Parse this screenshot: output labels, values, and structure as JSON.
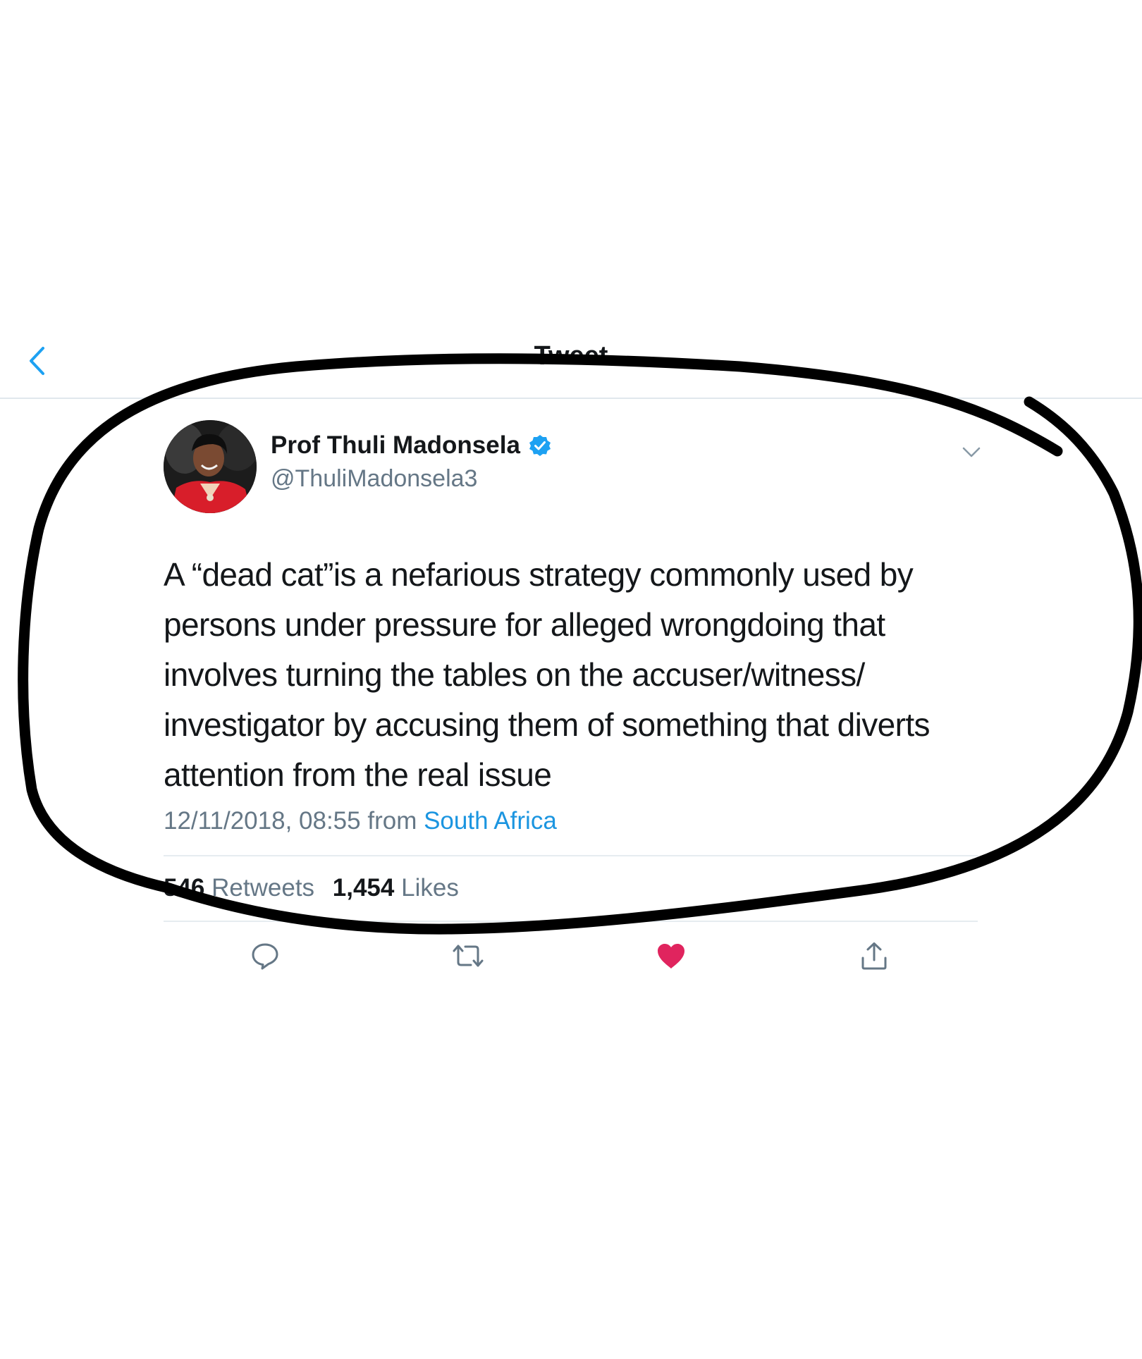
{
  "nav": {
    "title": "Tweet"
  },
  "tweet": {
    "author_name": "Prof Thuli Madonsela",
    "author_handle": "@ThuliMadonsela3",
    "verified": true,
    "text": "A “dead cat”is a nefarious strategy commonly used by\npersons under pressure for alleged wrongdoing that\ninvolves turning the tables on the accuser/witness/\ninvestigator by accusing them of something that diverts\nattention from the real issue",
    "timestamp": "12/11/2018, 08:55",
    "from_label": "from",
    "location": "South Africa"
  },
  "stats": {
    "retweets_count": "546",
    "retweets_label": "Retweets",
    "likes_count": "1,454",
    "likes_label": "Likes"
  },
  "actions": {
    "reply_icon": "reply-bubble-icon",
    "retweet_icon": "retweet-arrows-icon",
    "like_icon": "heart-icon",
    "share_icon": "share-upload-icon",
    "liked": true
  },
  "colors": {
    "link": "#1b95e0",
    "secondary_text": "#657786",
    "like_active": "#e0245e",
    "verified": "#1da1f2",
    "annotation_ink": "#000000"
  }
}
